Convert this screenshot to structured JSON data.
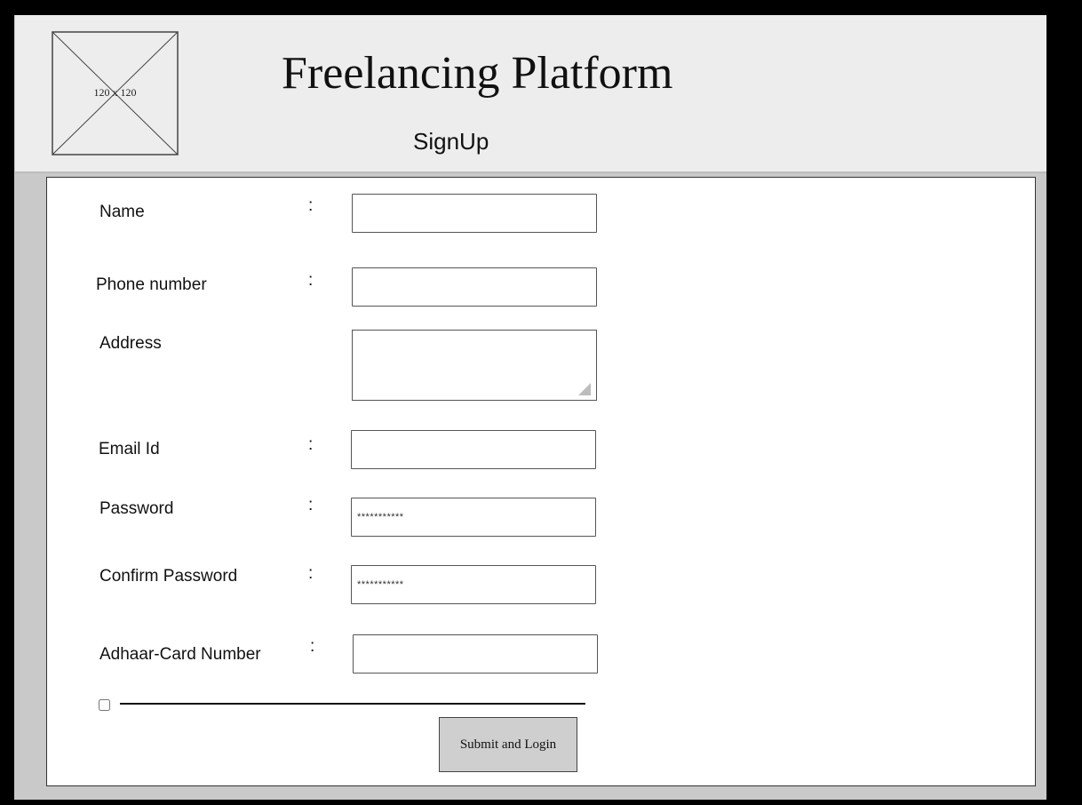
{
  "header": {
    "logo_placeholder": "120 x 120",
    "title": "Freelancing Platform",
    "subtitle": "SignUp"
  },
  "form": {
    "colon": ":",
    "name_label": "Name",
    "phone_label": "Phone number",
    "address_label": "Address",
    "email_label": "Email Id",
    "password_label": "Password",
    "password_value": "***********",
    "confirm_password_label": "Confirm Password",
    "confirm_password_value": "***********",
    "adhaar_label": "Adhaar-Card Number",
    "submit_label": "Submit and Login"
  }
}
